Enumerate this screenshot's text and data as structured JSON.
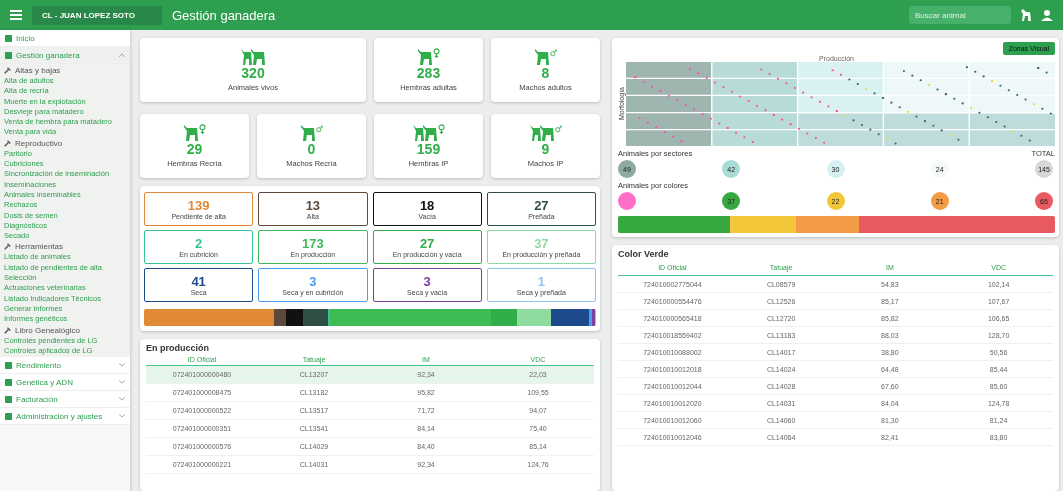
{
  "topbar": {
    "farm": "CL - JUAN LOPEZ SOTO",
    "title": "Gestión ganadera",
    "search": {
      "placeholder": "Buscar animal"
    }
  },
  "sidebar": {
    "items": [
      {
        "label": "Inicio",
        "kind": "link",
        "expanded": false
      },
      {
        "label": "Gestión ganadera",
        "kind": "group",
        "expanded": true,
        "sections": [
          {
            "title": "Altas y bajas",
            "links": [
              "Alta de adultos",
              "Alta de recría",
              "Muerte en la explotación",
              "Desvieje para matadero",
              "Venta de hembra para matadero",
              "Venta para vida"
            ]
          },
          {
            "title": "Reproductivo",
            "links": [
              "Paritorio",
              "Cubriciones",
              "Sincronización de inseminación",
              "Inseminaciones",
              "Animales inseminables",
              "Rechazos",
              "Dosis de semen",
              "Diagnósticos",
              "Secado"
            ]
          },
          {
            "title": "Herramientas",
            "links": [
              "Listado de animales",
              "Listado de pendientes de alta",
              "Selección",
              "Actuaciones veterinarias",
              "Listado Indicadores Técnicos",
              "Generar informes",
              "Informes genéticos"
            ]
          },
          {
            "title": "Libro Genealógico",
            "links": [
              "Controles pendientes de LG",
              "Controles aplicados de LG"
            ]
          }
        ]
      },
      {
        "label": "Rendimiento",
        "kind": "group",
        "expanded": false
      },
      {
        "label": "Genética y ADN",
        "kind": "group",
        "expanded": false
      },
      {
        "label": "Facturación",
        "kind": "group",
        "expanded": false
      },
      {
        "label": "Administración y ajustes",
        "kind": "group",
        "expanded": false
      }
    ]
  },
  "summary_cards": [
    {
      "value": "320",
      "label": "Animales vivos"
    },
    {
      "value": "283",
      "label": "Hembras adultas"
    },
    {
      "value": "8",
      "label": "Machos adultos"
    },
    {
      "value": "29",
      "label": "Hembras Recría"
    },
    {
      "value": "0",
      "label": "Machos Recría"
    },
    {
      "value": "159",
      "label": "Hembras IP"
    },
    {
      "value": "9",
      "label": "Machos IP"
    }
  ],
  "status_cards": [
    {
      "value": "139",
      "label": "Pendiente de alta",
      "color": "#e08a35"
    },
    {
      "value": "13",
      "label": "Alta",
      "color": "#5d4a3c"
    },
    {
      "value": "18",
      "label": "Vacía",
      "color": "#111111"
    },
    {
      "value": "27",
      "label": "Preñada",
      "color": "#2f4f45"
    },
    {
      "value": "2",
      "label": "En cubrición",
      "color": "#35c29a"
    },
    {
      "value": "173",
      "label": "En producción",
      "color": "#3dbb55"
    },
    {
      "value": "27",
      "label": "En producción y vacía",
      "color": "#2fae4a"
    },
    {
      "value": "37",
      "label": "En producción y preñada",
      "color": "#8fdc9e"
    },
    {
      "value": "41",
      "label": "Seca",
      "color": "#1d4a8c"
    },
    {
      "value": "3",
      "label": "Seca y en cubrición",
      "color": "#4a9ef0"
    },
    {
      "value": "3",
      "label": "Seca y vacía",
      "color": "#7b3fa0"
    },
    {
      "value": "1",
      "label": "Seca y preñada",
      "color": "#8ec4f5"
    }
  ],
  "production_table": {
    "title": "En producción",
    "columns": [
      "ID Oficial",
      "Tatuaje",
      "IM",
      "VDC"
    ],
    "rows": [
      {
        "cells": [
          "072401000000480",
          "CL13207",
          "92,34",
          "22,03"
        ],
        "selected": true
      },
      {
        "cells": [
          "072401000008475",
          "CL13182",
          "95,82",
          "109,55"
        ],
        "selected": false
      },
      {
        "cells": [
          "072401000000522",
          "CL13517",
          "71,72",
          "94,07"
        ],
        "selected": false
      },
      {
        "cells": [
          "072401000000351",
          "CL13541",
          "84,14",
          "75,40"
        ],
        "selected": false
      },
      {
        "cells": [
          "072401000000576",
          "CL14029",
          "84,40",
          "85,14"
        ],
        "selected": false
      },
      {
        "cells": [
          "072401000000221",
          "CL14031",
          "92,34",
          "124,76"
        ],
        "selected": false
      }
    ]
  },
  "sectors_panel": {
    "button": "Zonas Visual",
    "chart_title": "Producción",
    "chart_ylabel": "Morfología",
    "sectors_title": "Animales por sectores",
    "total_label": "TOTAL",
    "sectors": [
      {
        "value": "49",
        "color": "#8fa9a3"
      },
      {
        "value": "42",
        "color": "#a9dbd5"
      },
      {
        "value": "30",
        "color": "#d5f1f2"
      },
      {
        "value": "24",
        "color": "#f4f9fa"
      },
      {
        "value": "145",
        "color": "#d6d8d8"
      }
    ],
    "colors_title": "Animales por colores",
    "colors": [
      {
        "color": "#ff6fc8"
      },
      {
        "value": "37",
        "color": "#37a83f"
      },
      {
        "value": "22",
        "color": "#f2c83a"
      },
      {
        "value": "21",
        "color": "#f29a45"
      },
      {
        "value": "65",
        "color": "#e85a5f"
      }
    ]
  },
  "green_table": {
    "title": "Color Verde",
    "columns": [
      "ID Oficial",
      "Tatuaje",
      "IM",
      "VDC"
    ],
    "rows": [
      {
        "cells": [
          "724010002775044",
          "CL08579",
          "54,83",
          "102,14"
        ],
        "selected": false
      },
      {
        "cells": [
          "724010000554476",
          "CL12526",
          "85,17",
          "107,67"
        ],
        "selected": false
      },
      {
        "cells": [
          "724010000565418",
          "CL12720",
          "85,82",
          "106,65"
        ],
        "selected": false
      },
      {
        "cells": [
          "724010018559402",
          "CL13183",
          "88,03",
          "128,70"
        ],
        "selected": false
      },
      {
        "cells": [
          "724010010088002",
          "CL14017",
          "38,80",
          "50,56"
        ],
        "selected": false
      },
      {
        "cells": [
          "724010010012018",
          "CL14024",
          "64,48",
          "85,44"
        ],
        "selected": false
      },
      {
        "cells": [
          "724010010012044",
          "CL14028",
          "67,60",
          "85,60"
        ],
        "selected": false
      },
      {
        "cells": [
          "724010010012020",
          "CL14031",
          "84,04",
          "124,78"
        ],
        "selected": false
      },
      {
        "cells": [
          "724010010012060",
          "CL14060",
          "81,30",
          "81,24"
        ],
        "selected": false
      },
      {
        "cells": [
          "724010010012046",
          "CL14064",
          "82,41",
          "83,80"
        ],
        "selected": false
      }
    ]
  }
}
